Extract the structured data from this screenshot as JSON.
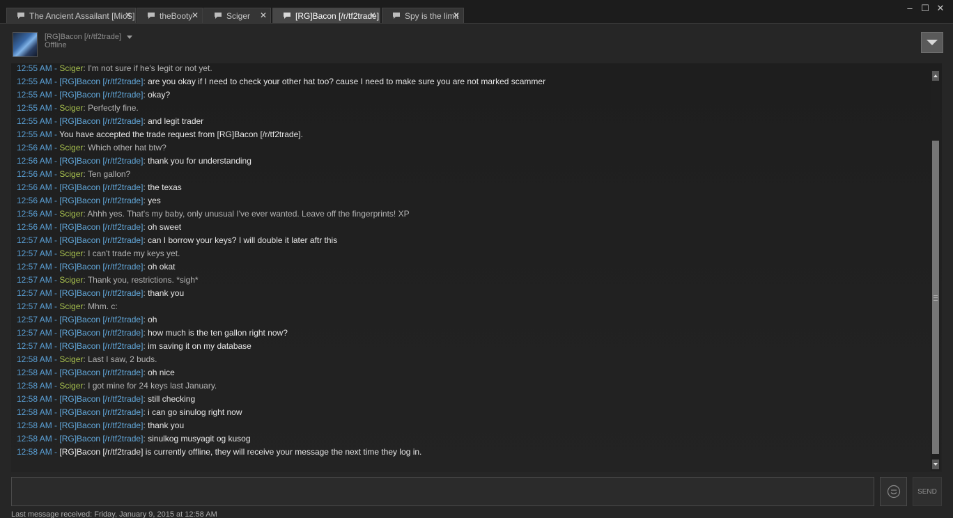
{
  "tabs": [
    {
      "label": "The Ancient Assailant [MicS]",
      "active": false
    },
    {
      "label": "theBooty",
      "active": false
    },
    {
      "label": "Sciger",
      "active": false
    },
    {
      "label": "[RG]Bacon [/r/tf2trade]",
      "active": true
    },
    {
      "label": "Spy is the limit",
      "active": false
    }
  ],
  "window_controls": {
    "minimize": "‒",
    "maximize": "☐",
    "close": "✕"
  },
  "friend": {
    "name": "[RG]Bacon [/r/tf2trade]",
    "status": "Offline"
  },
  "me_name": "Sciger",
  "messages": [
    {
      "time": "12:55 AM",
      "sender": "Sciger",
      "kind": "me",
      "text": "I'm not sure if he's legit or not yet."
    },
    {
      "time": "12:55 AM",
      "sender": "[RG]Bacon [/r/tf2trade]",
      "kind": "friend",
      "text": "are you okay if I need to check your other hat too? cause I need to make sure you are not marked scammer"
    },
    {
      "time": "12:55 AM",
      "sender": "[RG]Bacon [/r/tf2trade]",
      "kind": "friend",
      "text": "okay?"
    },
    {
      "time": "12:55 AM",
      "sender": "Sciger",
      "kind": "me",
      "text": "Perfectly fine."
    },
    {
      "time": "12:55 AM",
      "sender": "[RG]Bacon [/r/tf2trade]",
      "kind": "friend",
      "text": "and legit trader"
    },
    {
      "time": "12:55 AM",
      "sender": "",
      "kind": "system",
      "text": "You have accepted the trade request from [RG]Bacon [/r/tf2trade]."
    },
    {
      "time": "12:56 AM",
      "sender": "Sciger",
      "kind": "me",
      "text": "Which other hat btw?"
    },
    {
      "time": "12:56 AM",
      "sender": "[RG]Bacon [/r/tf2trade]",
      "kind": "friend",
      "text": "thank you for understanding"
    },
    {
      "time": "12:56 AM",
      "sender": "Sciger",
      "kind": "me",
      "text": "Ten gallon?"
    },
    {
      "time": "12:56 AM",
      "sender": "[RG]Bacon [/r/tf2trade]",
      "kind": "friend",
      "text": "the texas"
    },
    {
      "time": "12:56 AM",
      "sender": "[RG]Bacon [/r/tf2trade]",
      "kind": "friend",
      "text": "yes"
    },
    {
      "time": "12:56 AM",
      "sender": "Sciger",
      "kind": "me",
      "text": "Ahhh yes. That's my baby, only unusual I've ever wanted. Leave off the fingerprints! XP"
    },
    {
      "time": "12:56 AM",
      "sender": "[RG]Bacon [/r/tf2trade]",
      "kind": "friend",
      "text": "oh sweet"
    },
    {
      "time": "12:57 AM",
      "sender": "[RG]Bacon [/r/tf2trade]",
      "kind": "friend",
      "text": "can I borrow your keys? I will double it later aftr this"
    },
    {
      "time": "12:57 AM",
      "sender": "Sciger",
      "kind": "me",
      "text": "I can't trade my keys yet."
    },
    {
      "time": "12:57 AM",
      "sender": "[RG]Bacon [/r/tf2trade]",
      "kind": "friend",
      "text": "oh okat"
    },
    {
      "time": "12:57 AM",
      "sender": "Sciger",
      "kind": "me",
      "text": "Thank you, restrictions. *sigh*"
    },
    {
      "time": "12:57 AM",
      "sender": "[RG]Bacon [/r/tf2trade]",
      "kind": "friend",
      "text": "thank you"
    },
    {
      "time": "12:57 AM",
      "sender": "Sciger",
      "kind": "me",
      "text": "Mhm. c:"
    },
    {
      "time": "12:57 AM",
      "sender": "[RG]Bacon [/r/tf2trade]",
      "kind": "friend",
      "text": "oh"
    },
    {
      "time": "12:57 AM",
      "sender": "[RG]Bacon [/r/tf2trade]",
      "kind": "friend",
      "text": "how much is the ten gallon right now?"
    },
    {
      "time": "12:57 AM",
      "sender": "[RG]Bacon [/r/tf2trade]",
      "kind": "friend",
      "text": "im saving it on my database"
    },
    {
      "time": "12:58 AM",
      "sender": "Sciger",
      "kind": "me",
      "text": "Last I saw, 2 buds."
    },
    {
      "time": "12:58 AM",
      "sender": "[RG]Bacon [/r/tf2trade]",
      "kind": "friend",
      "text": "oh nice"
    },
    {
      "time": "12:58 AM",
      "sender": "Sciger",
      "kind": "me",
      "text": "I got mine for 24 keys last January."
    },
    {
      "time": "12:58 AM",
      "sender": "[RG]Bacon [/r/tf2trade]",
      "kind": "friend",
      "text": "still checking"
    },
    {
      "time": "12:58 AM",
      "sender": "[RG]Bacon [/r/tf2trade]",
      "kind": "friend",
      "text": "i can go sinulog right now"
    },
    {
      "time": "12:58 AM",
      "sender": "[RG]Bacon [/r/tf2trade]",
      "kind": "friend",
      "text": "thank you"
    },
    {
      "time": "12:58 AM",
      "sender": "[RG]Bacon [/r/tf2trade]",
      "kind": "friend",
      "text": "sinulkog musyagit og kusog"
    },
    {
      "time": "12:58 AM",
      "sender": "",
      "kind": "system",
      "text": "[RG]Bacon [/r/tf2trade] is currently offline, they will receive your message the next time they log in."
    }
  ],
  "input": {
    "value": "",
    "placeholder": ""
  },
  "send_label": "SEND",
  "footer_status": "Last message received: Friday, January 9, 2015 at 12:58 AM",
  "colors": {
    "friend_name": "#62a8db",
    "me_name": "#a7c04e",
    "timestamp": "#5aa0d6",
    "background": "#262626"
  }
}
